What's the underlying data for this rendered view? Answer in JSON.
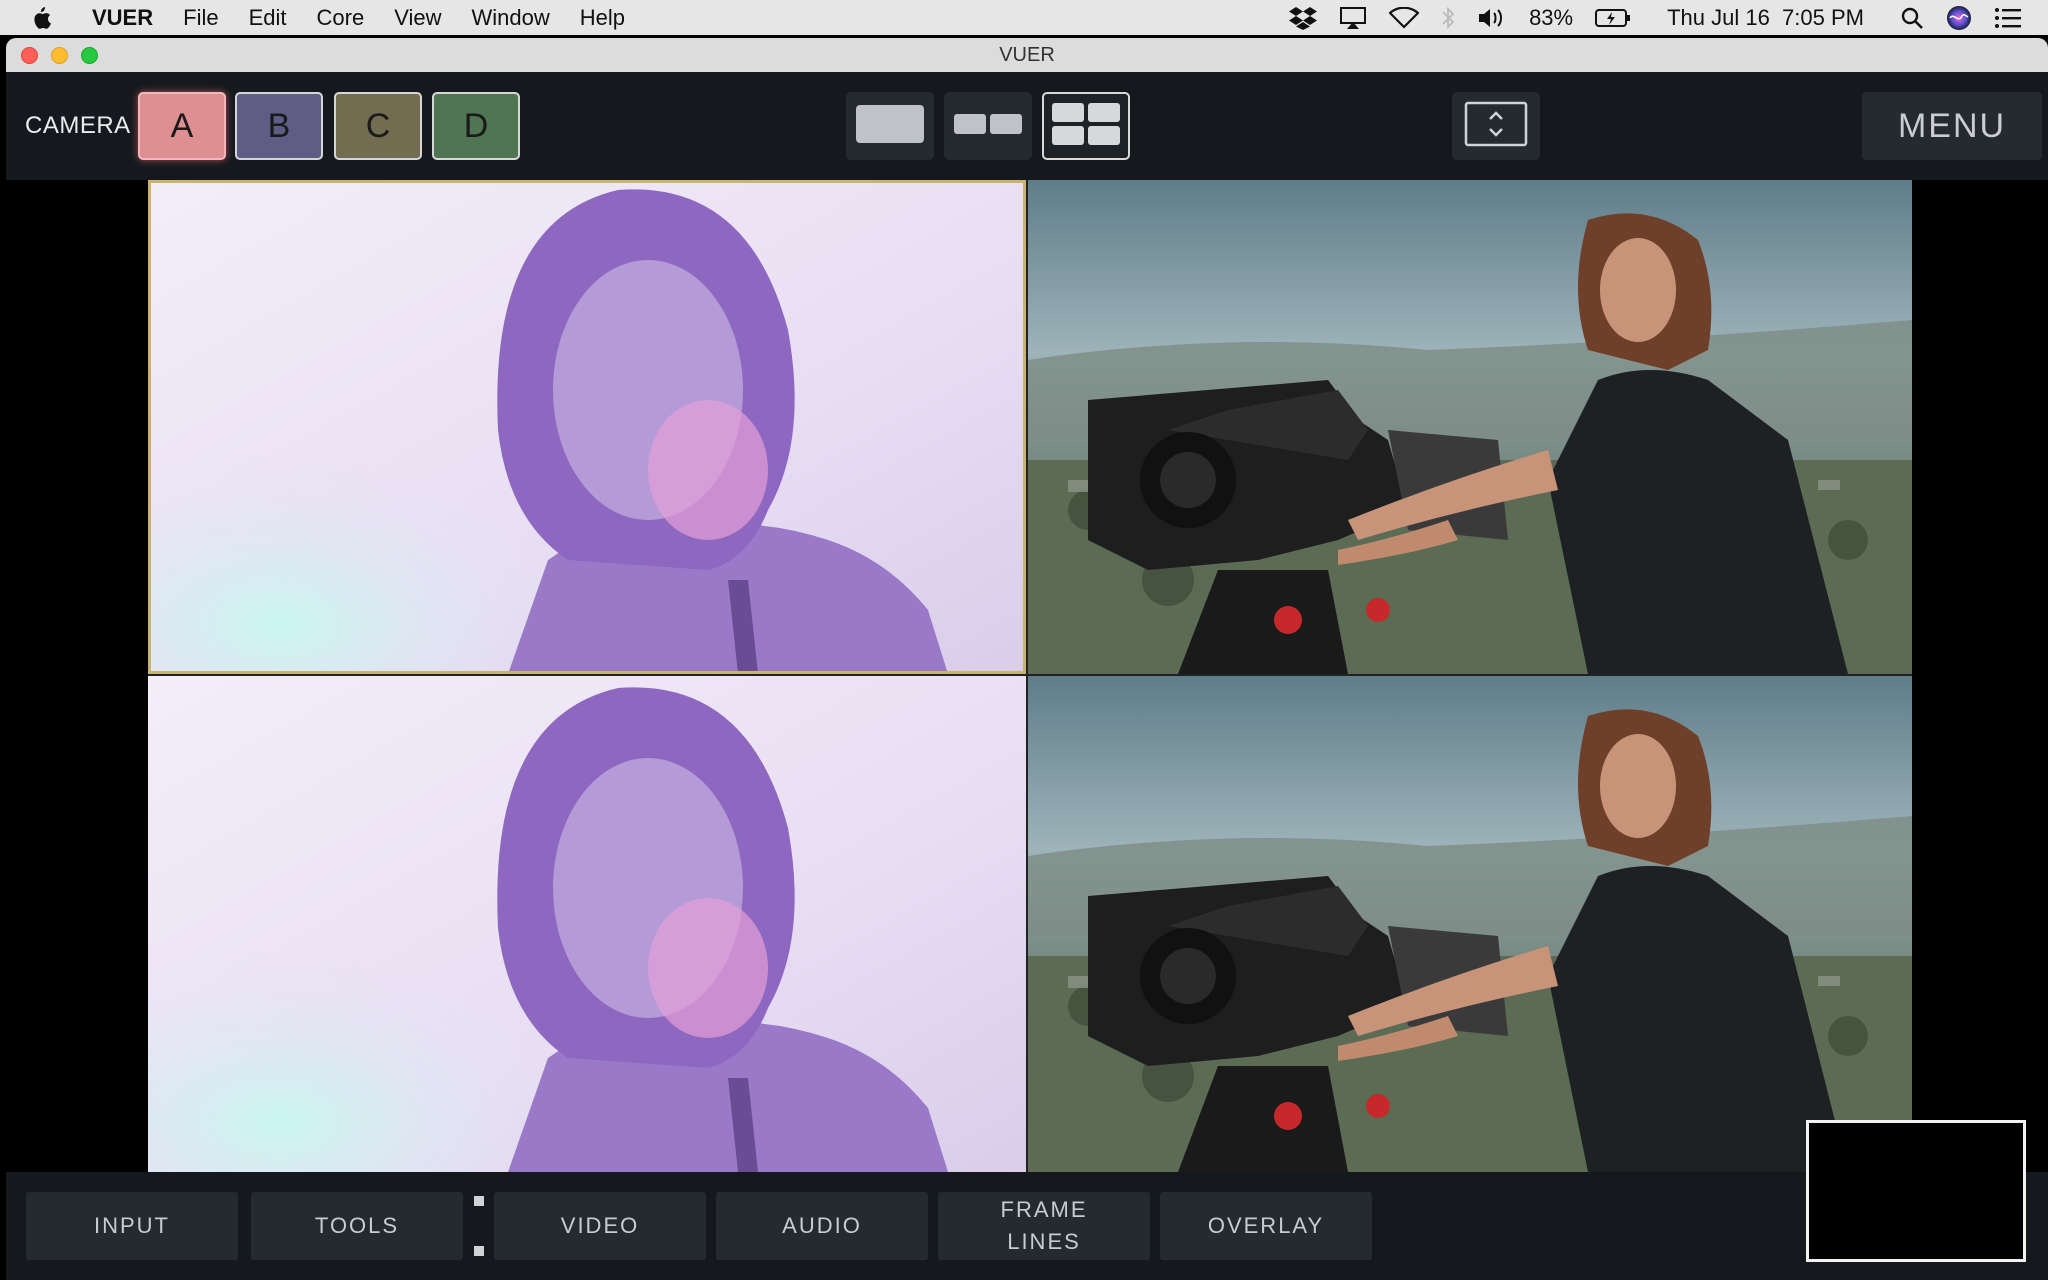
{
  "menubar": {
    "app_name": "VUER",
    "items": [
      "File",
      "Edit",
      "Core",
      "View",
      "Window",
      "Help"
    ],
    "battery": "83%",
    "datetime": "Thu Jul 16  7:05 PM",
    "icons": [
      "dropbox-icon",
      "airplay-icon",
      "wifi-icon",
      "bluetooth-icon",
      "volume-icon",
      "battery-icon",
      "search-icon",
      "siri-icon",
      "notification-center-icon"
    ]
  },
  "window": {
    "title": "VUER"
  },
  "toolbar": {
    "camera_label": "CAMERA",
    "cameras": [
      {
        "label": "A",
        "color": "#dd8f92",
        "selected": true
      },
      {
        "label": "B",
        "color": "#5f5d85",
        "selected": false
      },
      {
        "label": "C",
        "color": "#726c51",
        "selected": false
      },
      {
        "label": "D",
        "color": "#4f7552",
        "selected": false
      }
    ],
    "layouts": [
      "single-view-icon",
      "dual-view-icon",
      "quad-view-icon"
    ],
    "active_layout": "quad",
    "fit_icon": "fit-toggle-icon",
    "menu_label": "MENU"
  },
  "feeds": [
    {
      "name": "Camera A",
      "style": "washed-purple",
      "selected": true
    },
    {
      "name": "Camera B",
      "style": "natural",
      "selected": false
    },
    {
      "name": "Camera C",
      "style": "washed-purple",
      "selected": false
    },
    {
      "name": "Camera D",
      "style": "natural",
      "selected": false
    }
  ],
  "bottombar": {
    "tabs": {
      "input": "INPUT",
      "tools": "TOOLS",
      "video": "VIDEO",
      "audio": "AUDIO",
      "frame_lines": "FRAME\nLINES",
      "overlay": "OVERLAY"
    }
  },
  "colors": {
    "toolbar_bg": "#15191d",
    "button_bg": "#242a30",
    "selected_outline": "#c8b470"
  }
}
